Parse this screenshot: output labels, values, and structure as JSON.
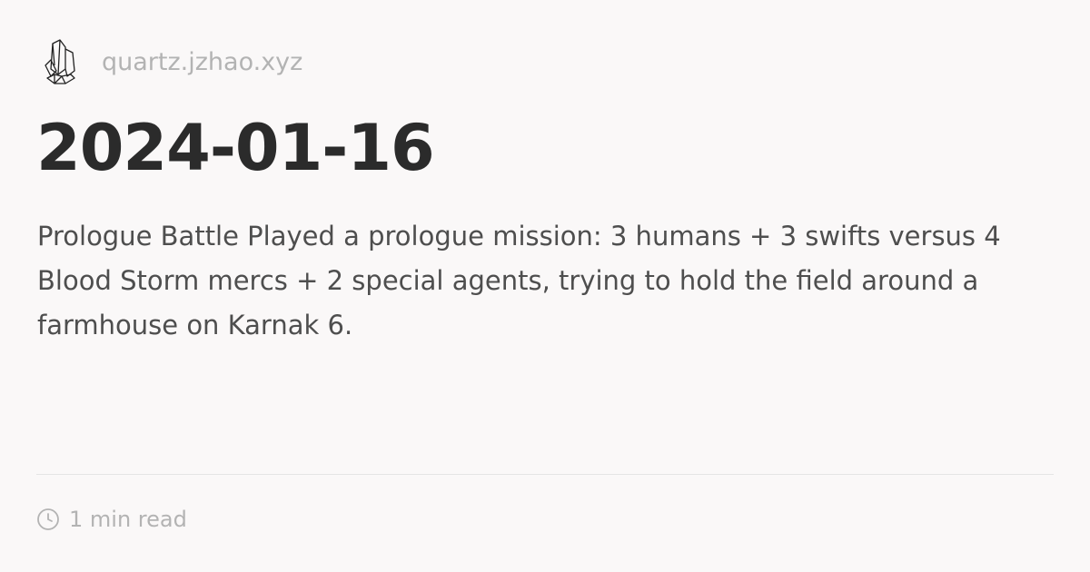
{
  "header": {
    "site_name": "quartz.jzhao.xyz",
    "logo_icon": "crystal-icon"
  },
  "title": "2024-01-16",
  "description": "Prologue Battle Played a prologue mission: 3 humans + 3 swifts versus 4 Blood Storm mercs + 2 special agents, trying to hold the field around a farmhouse on Karnak 6.",
  "meta": {
    "read_time": "1 min read",
    "icon": "clock-icon"
  }
}
